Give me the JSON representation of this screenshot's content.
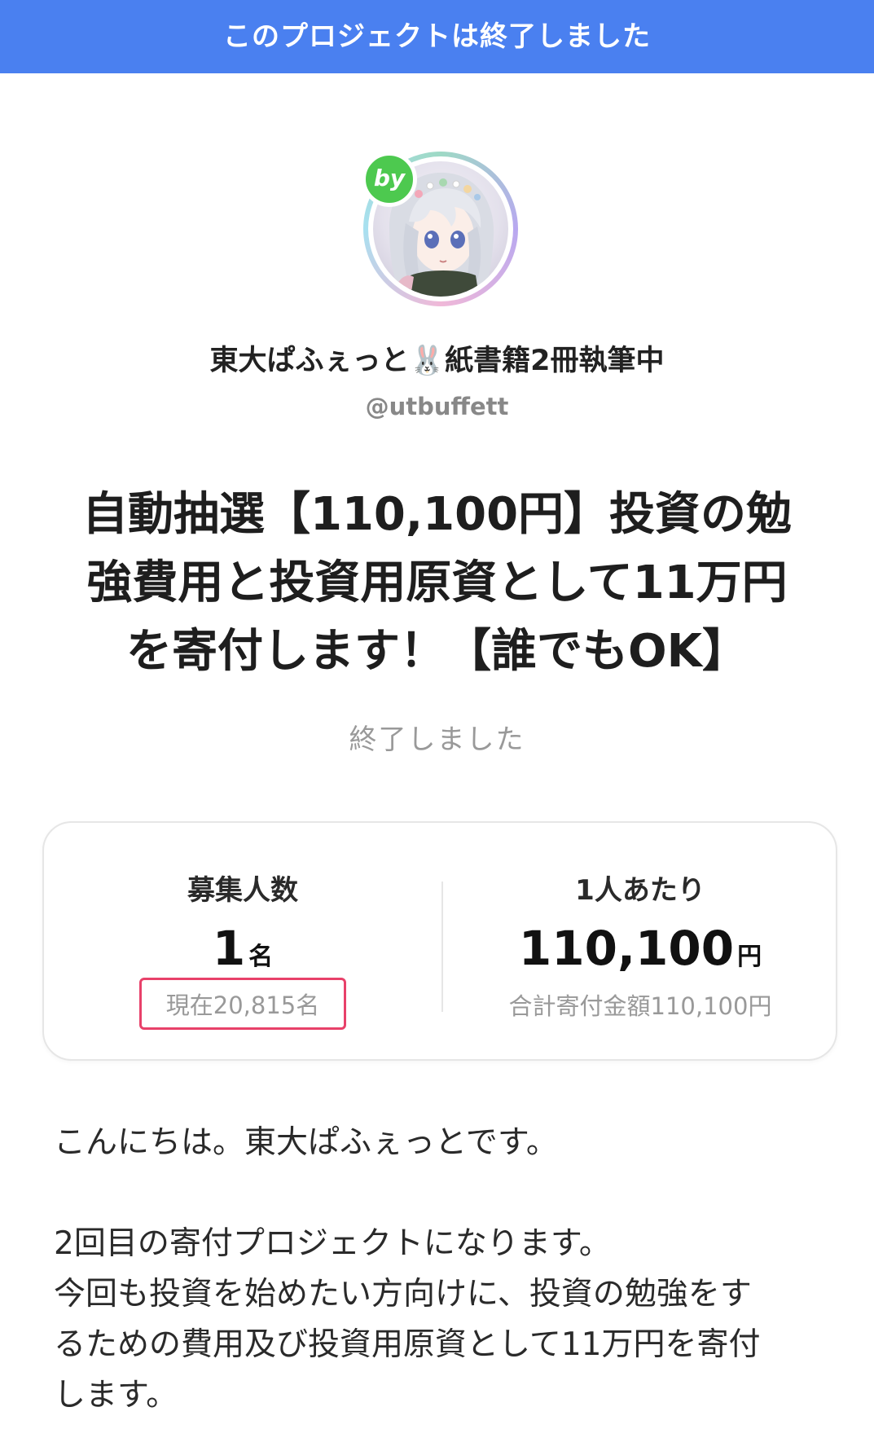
{
  "banner": {
    "text": "このプロジェクトは終了しました"
  },
  "creator": {
    "badge": "by",
    "name": "東大ぱふぇっと🐰紙書籍2冊執筆中",
    "handle": "@utbuffett"
  },
  "project": {
    "title_lines": [
      "自動抽選【110,100円】投資の勉",
      "強費用と投資用原資として11万円",
      "を寄付します！【誰でもOK】"
    ],
    "status": "終了しました"
  },
  "stats": {
    "recruit": {
      "label": "募集人数",
      "value": "1",
      "unit": "名",
      "current": "現在20,815名"
    },
    "per_person": {
      "label": "1人あたり",
      "value": "110,100",
      "unit": "円",
      "total": "合計寄付金額110,100円"
    }
  },
  "body": {
    "greeting": "こんにちは。東大ぱふぇっとです。",
    "lines": [
      "2回目の寄付プロジェクトになります。",
      "今回も投資を始めたい方向けに、投資の勉強をす",
      "るための費用及び投資用原資として11万円を寄付",
      "します。"
    ]
  },
  "colors": {
    "banner_bg": "#4a80f0",
    "badge_bg": "#4dc94f",
    "highlight": "#e8416a"
  }
}
